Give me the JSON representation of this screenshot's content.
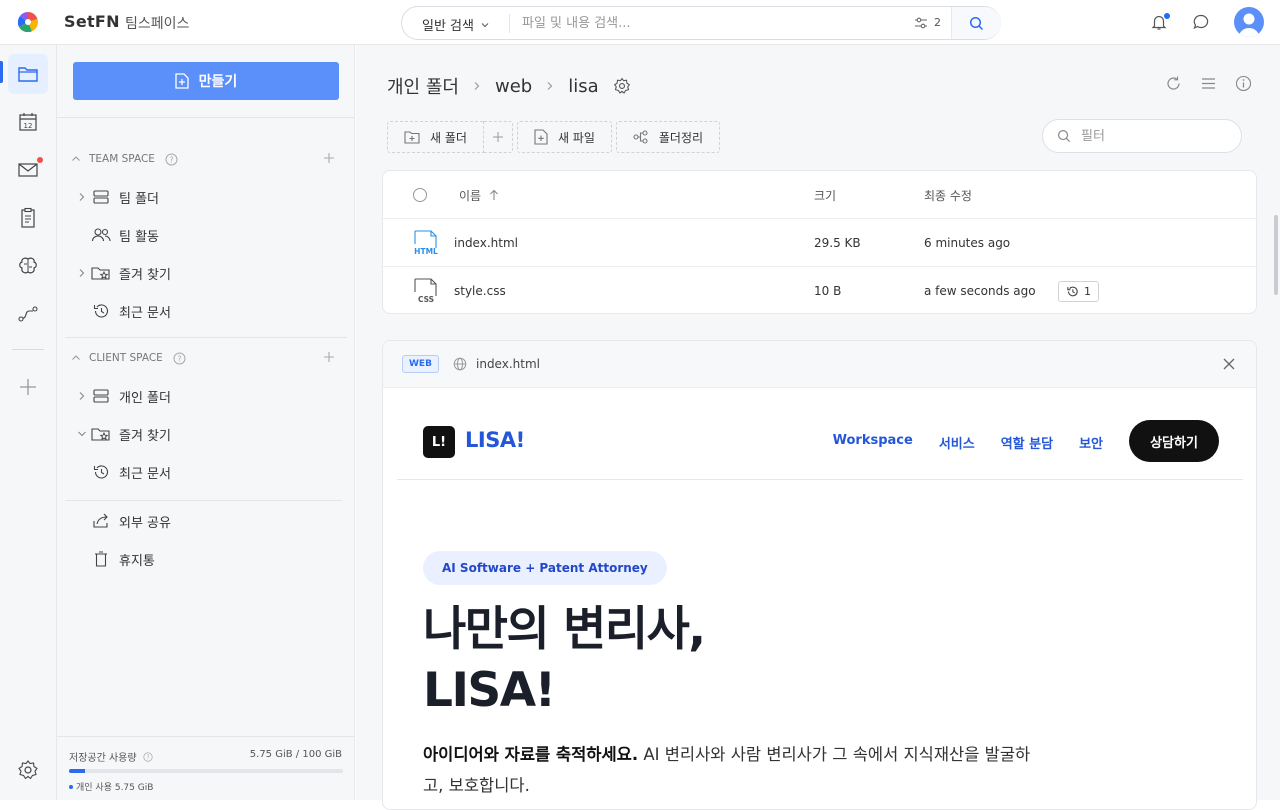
{
  "app": {
    "brand": "SetFN",
    "workspace": "팀스페이스"
  },
  "search": {
    "mode": "일반 검색",
    "placeholder": "파일 및 내용 검색...",
    "filter_count": "2"
  },
  "sidebar": {
    "create_label": "만들기",
    "team_space": {
      "title": "TEAM SPACE",
      "items": [
        {
          "label": "팀 폴더",
          "icon": "server-folder-icon",
          "expandable": true
        },
        {
          "label": "팀 활동",
          "icon": "people-icon",
          "expandable": false
        },
        {
          "label": "즐겨 찾기",
          "icon": "star-folder-icon",
          "expandable": true
        },
        {
          "label": "최근 문서",
          "icon": "history-icon",
          "expandable": false
        }
      ]
    },
    "client_space": {
      "title": "CLIENT SPACE",
      "items": [
        {
          "label": "개인 폴더",
          "icon": "server-folder-icon",
          "expandable": true
        },
        {
          "label": "즐겨 찾기",
          "icon": "star-folder-icon",
          "expandable": true
        },
        {
          "label": "최근 문서",
          "icon": "history-icon",
          "expandable": false
        }
      ]
    },
    "extra": [
      {
        "label": "외부 공유",
        "icon": "share-icon"
      },
      {
        "label": "휴지통",
        "icon": "trash-icon"
      }
    ],
    "storage": {
      "title": "저장공간 사용량",
      "value": "5.75 GiB / 100 GiB",
      "used_fraction": 0.0575,
      "personal": "개인 사용 5.75 GiB"
    }
  },
  "breadcrumb": [
    "개인 폴더",
    "web",
    "lisa"
  ],
  "toolbar": {
    "new_folder": "새 폴더",
    "new_file": "새 파일",
    "organize": "폴더정리",
    "filter_placeholder": "필터"
  },
  "table": {
    "headers": {
      "name": "이름",
      "size": "크기",
      "modified": "최종 수정"
    },
    "rows": [
      {
        "type": "HTML",
        "name": "index.html",
        "size": "29.5 KB",
        "modified": "6 minutes ago",
        "versions": ""
      },
      {
        "type": "CSS",
        "name": "style.css",
        "size": "10 B",
        "modified": "a few seconds ago",
        "versions": "1"
      }
    ]
  },
  "preview": {
    "tag": "WEB",
    "filename": "index.html",
    "site": {
      "logo_mark": "L!",
      "name": "LISA!",
      "nav": [
        "Workspace",
        "서비스",
        "역할 분담",
        "보안"
      ],
      "cta": "상담하기",
      "pill": "AI Software + Patent Attorney",
      "title_line1": "나만의 변리사,",
      "title_line2": "LISA!",
      "desc_bold": "아이디어와 자료를 축적하세요.",
      "desc_rest": " AI 변리사와 사람 변리사가 그 속에서 지식재산을 발굴하고, 보호합니다."
    }
  },
  "colors": {
    "accent": "#5b8ff9",
    "site_blue": "#2356d8",
    "notification": "#f0504b"
  }
}
